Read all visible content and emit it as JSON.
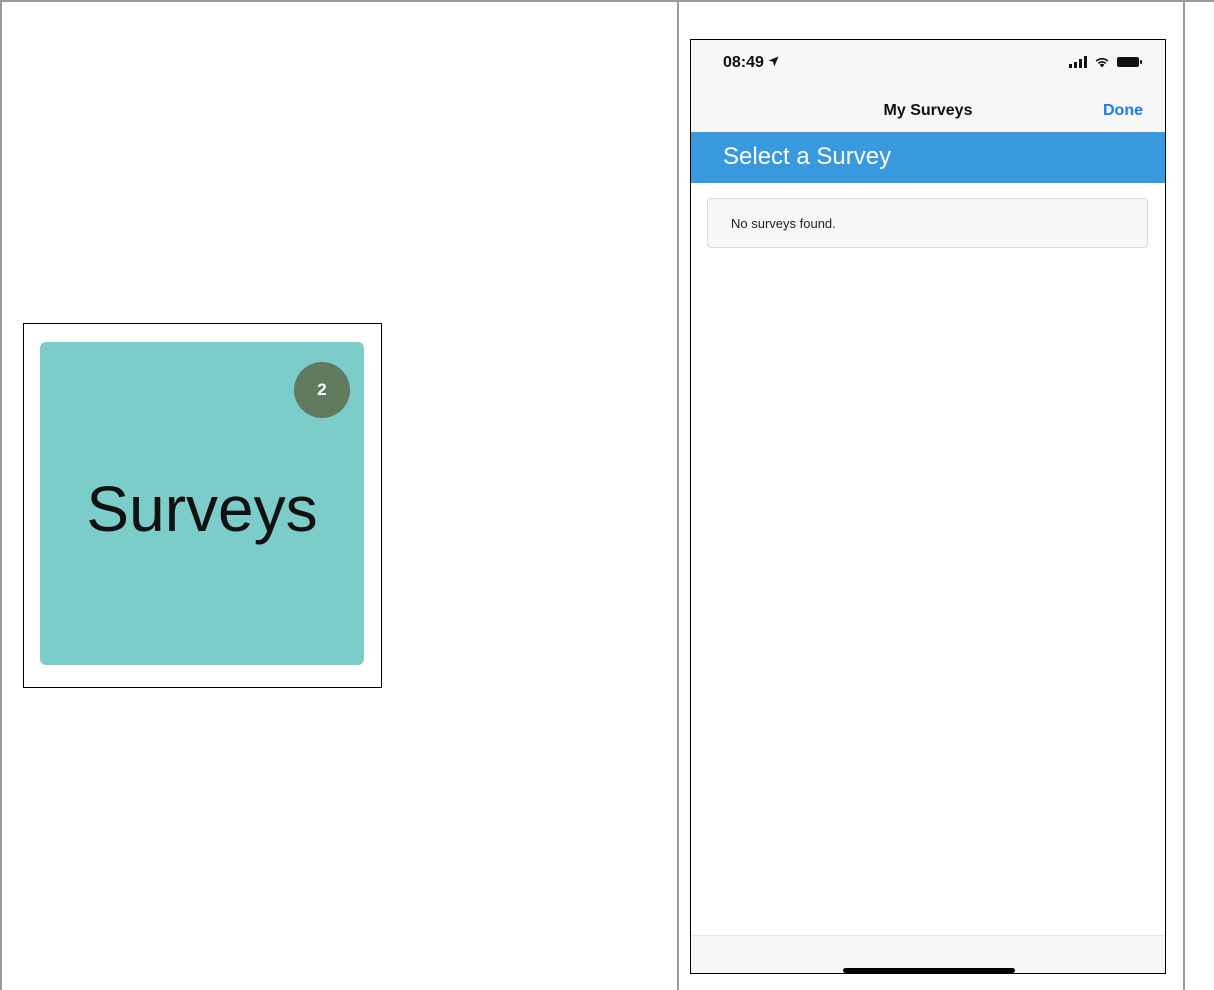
{
  "tile": {
    "label": "Surveys",
    "badge_count": "2",
    "background_color": "#7ccdca",
    "badge_color": "#5f7a5c"
  },
  "phone": {
    "status_bar": {
      "time": "08:49",
      "location_icon": "location-arrow-icon",
      "signal_icon": "cellular-signal-icon",
      "wifi_icon": "wifi-icon",
      "battery_icon": "battery-icon"
    },
    "nav": {
      "title": "My Surveys",
      "done_label": "Done",
      "done_color": "#1a7cf3"
    },
    "header": {
      "title": "Select a Survey",
      "background_color": "#3999de"
    },
    "notice": {
      "message": "No surveys found."
    }
  }
}
